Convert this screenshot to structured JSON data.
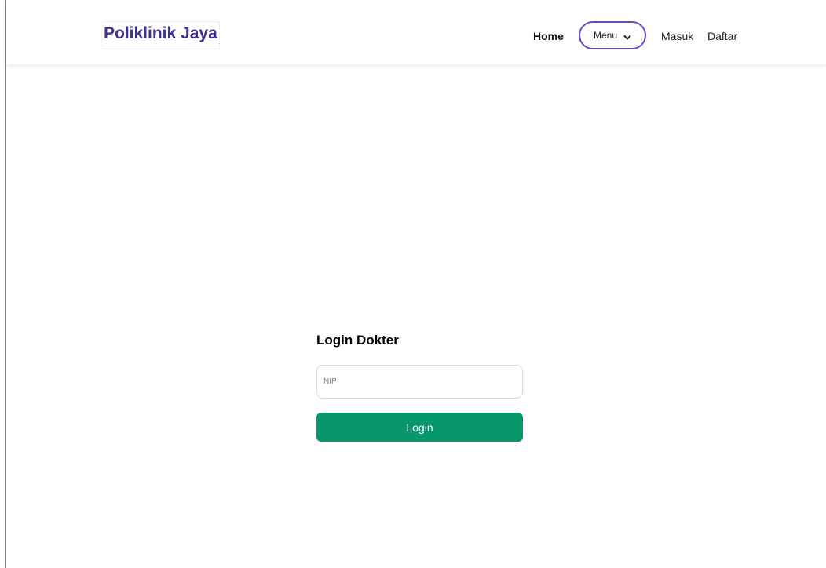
{
  "navbar": {
    "brand": "Poliklinik Jaya",
    "links": {
      "home": "Home",
      "menu": "Menu",
      "masuk": "Masuk",
      "daftar": "Daftar"
    },
    "menu_icon": "chevron-down-icon"
  },
  "login": {
    "title": "Login Dokter",
    "nip_placeholder": "NIP",
    "nip_value": "",
    "button_label": "Login"
  },
  "colors": {
    "brand": "#3b3294",
    "menu_border": "#5a4fd6",
    "login_button": "#06976a"
  }
}
